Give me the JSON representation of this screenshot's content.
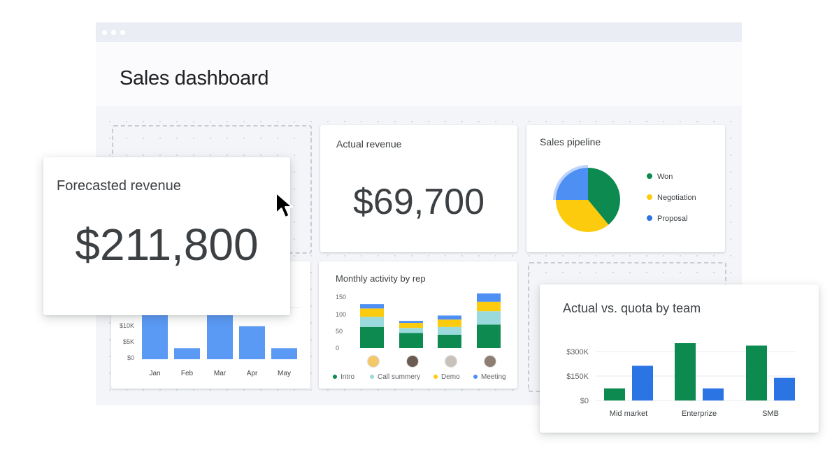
{
  "window": {
    "title": "Sales dashboard"
  },
  "colors": {
    "green": "#0d8a4f",
    "yellow": "#fccb0d",
    "blue": "#4e8ff4",
    "lightblue": "#9adadd",
    "barblue": "#5a9af5",
    "quotablue": "#2b74e4"
  },
  "cards": {
    "forecast": {
      "title": "Forecasted revenue",
      "value": "$211,800"
    },
    "actual": {
      "title": "Actual revenue",
      "value": "$69,700"
    },
    "pipeline": {
      "title": "Sales pipeline",
      "legend": [
        {
          "label": "Won",
          "color": "#0d8a4f"
        },
        {
          "label": "Negotiation",
          "color": "#fccb0d"
        },
        {
          "label": "Proposal",
          "color": "#4e8ff4"
        }
      ]
    },
    "activity": {
      "title": "Monthly activity by rep",
      "legend": [
        {
          "label": "Intro",
          "color": "#0d8a4f"
        },
        {
          "label": "Call summery",
          "color": "#9adadd"
        },
        {
          "label": "Demo",
          "color": "#fccb0d"
        },
        {
          "label": "Meeting",
          "color": "#4e8ff4"
        }
      ]
    },
    "quota": {
      "title": "Actual vs. quota by team"
    }
  },
  "chart_data": [
    {
      "id": "sales-pipeline",
      "type": "pie",
      "categories": [
        "Won",
        "Negotiation",
        "Proposal"
      ],
      "values": [
        39,
        36,
        25
      ],
      "colors": [
        "#0d8a4f",
        "#fccb0d",
        "#4e8ff4"
      ]
    },
    {
      "id": "monthly-activity",
      "type": "bar",
      "stacked": true,
      "categories": [
        "Rep 1",
        "Rep 2",
        "Rep 3",
        "Rep 4"
      ],
      "series": [
        {
          "name": "Intro",
          "values": [
            63,
            45,
            40,
            70
          ]
        },
        {
          "name": "Call summery",
          "values": [
            30,
            15,
            23,
            40
          ]
        },
        {
          "name": "Demo",
          "values": [
            25,
            15,
            22,
            28
          ]
        },
        {
          "name": "Meeting",
          "values": [
            13,
            6,
            12,
            25
          ]
        }
      ],
      "yticks": [
        "0",
        "50",
        "100",
        "150"
      ],
      "ylim": [
        0,
        150
      ]
    },
    {
      "id": "monthly-revenue",
      "type": "bar",
      "categories": [
        "Jan",
        "Feb",
        "Mar",
        "Apr",
        "May"
      ],
      "values": [
        16,
        3.5,
        16,
        10.5,
        3.5
      ],
      "yticks": [
        "$0",
        "$5K",
        "$10K"
      ],
      "ylim": [
        0,
        10
      ]
    },
    {
      "id": "actual-vs-quota",
      "type": "bar",
      "categories": [
        "Mid market",
        "Enterprize",
        "SMB"
      ],
      "series": [
        {
          "name": "Actual",
          "values": [
            75,
            355,
            340
          ]
        },
        {
          "name": "Quota",
          "values": [
            215,
            75,
            140
          ]
        }
      ],
      "yticks": [
        "$0",
        "$150K",
        "$300K"
      ],
      "ylim": [
        0,
        300
      ]
    }
  ]
}
